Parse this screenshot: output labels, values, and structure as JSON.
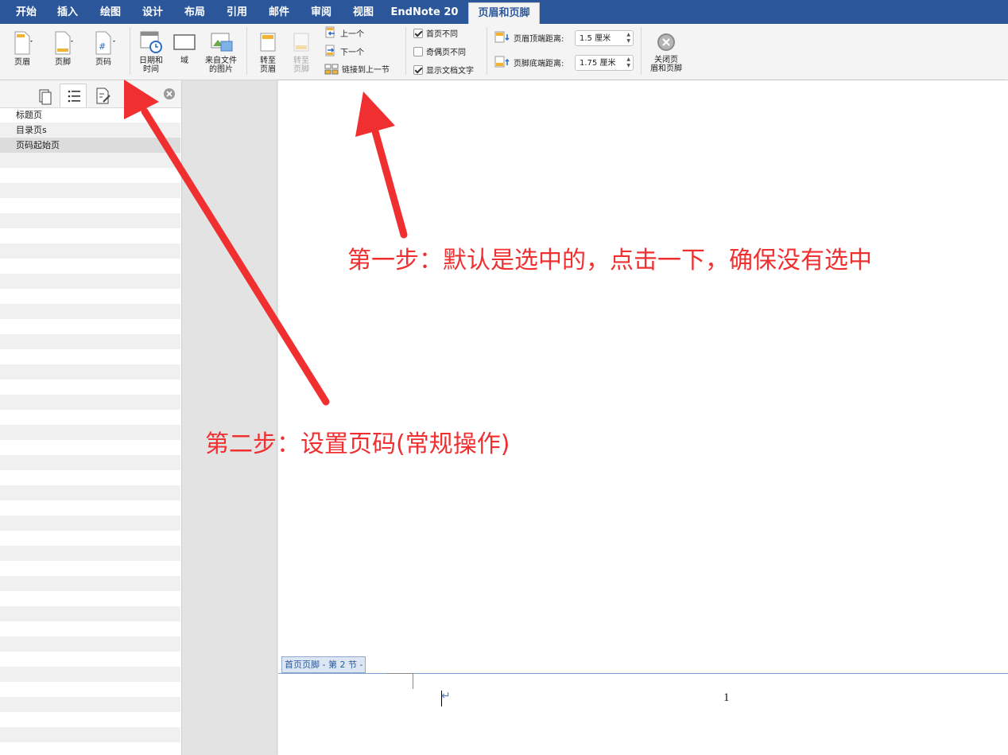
{
  "tabs": [
    {
      "label": "开始",
      "active": false
    },
    {
      "label": "插入",
      "active": false
    },
    {
      "label": "绘图",
      "active": false
    },
    {
      "label": "设计",
      "active": false
    },
    {
      "label": "布局",
      "active": false
    },
    {
      "label": "引用",
      "active": false
    },
    {
      "label": "邮件",
      "active": false
    },
    {
      "label": "审阅",
      "active": false
    },
    {
      "label": "视图",
      "active": false
    },
    {
      "label": "EndNote 20",
      "active": false
    },
    {
      "label": "页眉和页脚",
      "active": true
    }
  ],
  "ribbon": {
    "header": "页眉",
    "footer": "页脚",
    "page_number": "页码",
    "date_time": "日期和\n时间",
    "field": "域",
    "picture_from_file": "来自文件\n的图片",
    "goto_header": "转至\n页眉",
    "goto_footer": "转至\n页脚",
    "previous": "上一个",
    "next": "下一个",
    "link_to_previous": "链接到上一节",
    "different_first_page": {
      "label": "首页不同",
      "checked": true
    },
    "different_odd_even": {
      "label": "奇偶页不同",
      "checked": false
    },
    "show_document_text": {
      "label": "显示文档文字",
      "checked": true
    },
    "header_from_top_label": "页眉顶端距离:",
    "header_from_top_value": "1.5 厘米",
    "footer_from_bottom_label": "页脚底端距离:",
    "footer_from_bottom_value": "1.75 厘米",
    "close": "关闭页\n眉和页脚"
  },
  "nav_pane": {
    "items": [
      "标题页",
      "目录页s",
      "页码起始页"
    ],
    "selected_index": 2
  },
  "document": {
    "footer_tag": "首页页脚 - 第 2 节 -",
    "page_number_value": "1"
  },
  "annotations": {
    "step1": "第一步：默认是选中的，点击一下，确保没有选中",
    "step2": "第二步：设置页码(常规操作)"
  },
  "colors": {
    "tabbar": "#2b579a",
    "annotation_red": "#f03030",
    "ribbon_bg": "#f4f4f4"
  }
}
